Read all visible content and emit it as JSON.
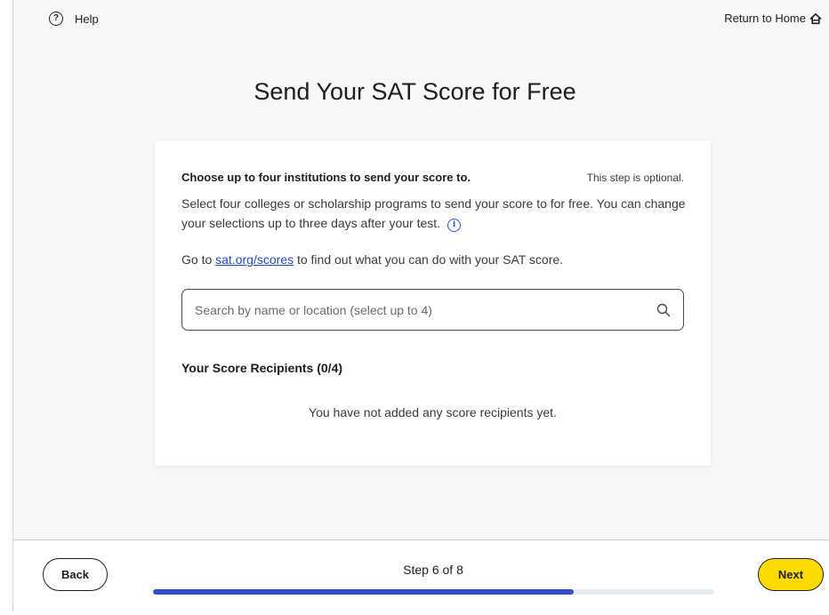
{
  "header": {
    "help_label": "Help",
    "help_icon": "question-circle-icon",
    "return_home_label": "Return to Home",
    "home_icon": "home-icon"
  },
  "page": {
    "title": "Send Your SAT Score for Free"
  },
  "card": {
    "heading": "Choose up to four institutions to send your score to.",
    "optional_note": "This step is optional.",
    "description": "Select four colleges or scholarship programs to send your score to for free. You can change your selections up to three days after your test.",
    "goto_prefix": "Go to ",
    "goto_link": "sat.org/scores",
    "goto_suffix": " to find out what you can do with your SAT score.",
    "search_placeholder": "Search by name or location (select up to 4)",
    "search_value": "",
    "recipients_title": "Your Score Recipients (0/4)",
    "empty_message": "You have not added any score recipients yet."
  },
  "footer": {
    "back_label": "Back",
    "next_label": "Next",
    "step_label": "Step 6 of 8",
    "progress_fraction": 0.75
  },
  "colors": {
    "accent": "#324dc7",
    "next_button": "#fedb00",
    "link": "#2347c9"
  }
}
